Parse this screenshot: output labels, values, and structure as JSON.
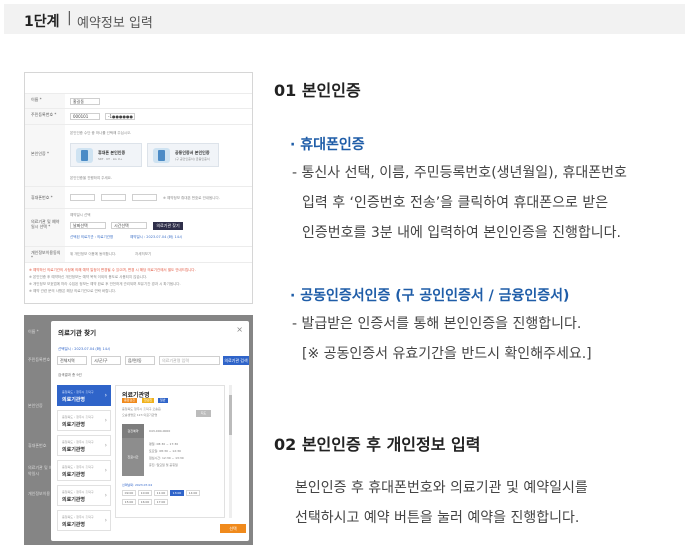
{
  "header": {
    "step": "1단계",
    "separator": "|",
    "title": "예약정보 입력"
  },
  "section1": {
    "title": "01 본인인증",
    "mobile": {
      "bullet": "·",
      "title": "휴대폰인증",
      "lines": [
        "- 통신사 선택, 이름, 주민등록번호(생년월일), 휴대폰번호",
        "입력 후 ‘인증번호 전송’을 클릭하여 휴대폰으로 받은",
        "인증번호를 3분 내에 입력하여 본인인증을 진행합니다."
      ]
    },
    "cert": {
      "bullet": "·",
      "title": "공동인증서인증 (구 공인인증서 / 금융인증서)",
      "lines": [
        "- 발급받은 인증서를 통해 본인인증을 진행합니다.",
        "[※ 공동인증서 유효기간을 반드시 확인해주세요.]"
      ]
    }
  },
  "section2": {
    "title": "02 본인인증 후 개인정보 입력",
    "lines": [
      "본인인증 후 휴대폰번호와 의료기관 및 예약일시를",
      "선택하시고 예약 버튼을 눌러 예약을 진행합니다."
    ]
  },
  "form_shot": {
    "rows": {
      "name": {
        "label": "이름 *",
        "value": "홍길동"
      },
      "rrn": {
        "label": "주민등록번호 *",
        "front": "000101",
        "back": "-1●●●●●●"
      },
      "auth": {
        "label": "본인인증 *",
        "guide": "본인인증 수단 중 하나를 선택해 주십시오.",
        "card1_title": "휴대폰 본인인증",
        "card1_sub": "SKT · KT · LG U+",
        "card2_title": "공동인증서 본인인증",
        "card2_sub": "(구 공인인증서) 금융인증서",
        "note": "본인인증을 진행하여 주세요."
      },
      "phone": {
        "label": "휴대폰번호 *",
        "note": "※ 예약정보 휴대폰 번호로 안내됩니다."
      },
      "hospital": {
        "label": "의료기관 및 예약일시 선택 *",
        "guide": "예약일시 선택",
        "date_placeholder": "날짜선택",
        "time_placeholder": "시간선택",
        "button": "의료기관 찾기",
        "selected": "선택된 의료기관 : 의료기관명",
        "selected_date": "예약일시 : 2023.07.04 (화) 14시"
      },
      "consent": {
        "label": "개인정보이용동의 *",
        "text": "위 개인정보 이용에 동의합니다.",
        "link": "자세히보기"
      }
    },
    "notices": [
      "※ 예약하신 의료기관의 사정에 의해 예약 일정이 변경될 수 있으며, 변경 시 해당 의료기관에서 별도 안내드립니다.",
      "※ 본인인증 후 예약하신 개인정보는 예약 목적 이외의 용도로 사용되지 않습니다.",
      "※ 개인정보 보호법에 따라 수집된 정보는 예약 완료 후 안전하게 관리되며 보유기간 경과 시 파기됩니다.",
      "※ 예약 관련 문의 사항은 해당 의료기관으로 연락 바랍니다."
    ]
  },
  "modal_shot": {
    "bg_labels": [
      "이름 *",
      "주민등록번호",
      "본인인증",
      "휴대폰번호",
      "의료기관 및 예약일시",
      "개인정보이용"
    ],
    "title": "의료기관 찾기",
    "close": "×",
    "selected_date": "선택일시 : 2023.07.04 (화) 14시",
    "selects": [
      "전체지역",
      "시/군/구",
      "읍/면/동"
    ],
    "search_placeholder": "의료기관명 입력",
    "search_button": "의료기관 검색",
    "result_label": "검색결과 총 9건",
    "list": [
      {
        "sub": "충청북도 › 청주시 흥덕구",
        "name": "의료기관명"
      },
      {
        "sub": "충청북도 › 청주시 흥덕구",
        "name": "의료기관명"
      },
      {
        "sub": "충청북도 › 청주시 흥덕구",
        "name": "의료기관명"
      },
      {
        "sub": "충청북도 › 청주시 흥덕구",
        "name": "의료기관명"
      },
      {
        "sub": "충청북도 › 청주시 흥덕구",
        "name": "의료기관명"
      },
      {
        "sub": "충청북도 › 청주시 흥덕구",
        "name": "의료기관명"
      }
    ],
    "arrow": "›",
    "detail": {
      "name": "의료기관명",
      "tags": [
        "종합검진",
        "암검진",
        "일반"
      ],
      "addr": "충청북도 청주시 흥덕구 오송읍",
      "addr2": "오송생명로 123 의료기관명",
      "map_button": "지도",
      "block1": "검진예약",
      "block2": "진료시간",
      "phone": "043-000-0000",
      "hours": [
        "평일: 08:30 ~ 17:30",
        "토요일: 08:30 ~ 12:30",
        "점심시간: 12:30 ~ 13:30",
        "휴진: 일요일 및 공휴일"
      ],
      "date_label": "선택날짜: 2023.07.04",
      "times": [
        "09:00",
        "10:00",
        "11:00",
        "13:00",
        "14:00",
        "15:00",
        "16:00",
        "17:00"
      ]
    },
    "confirm": "선택"
  }
}
